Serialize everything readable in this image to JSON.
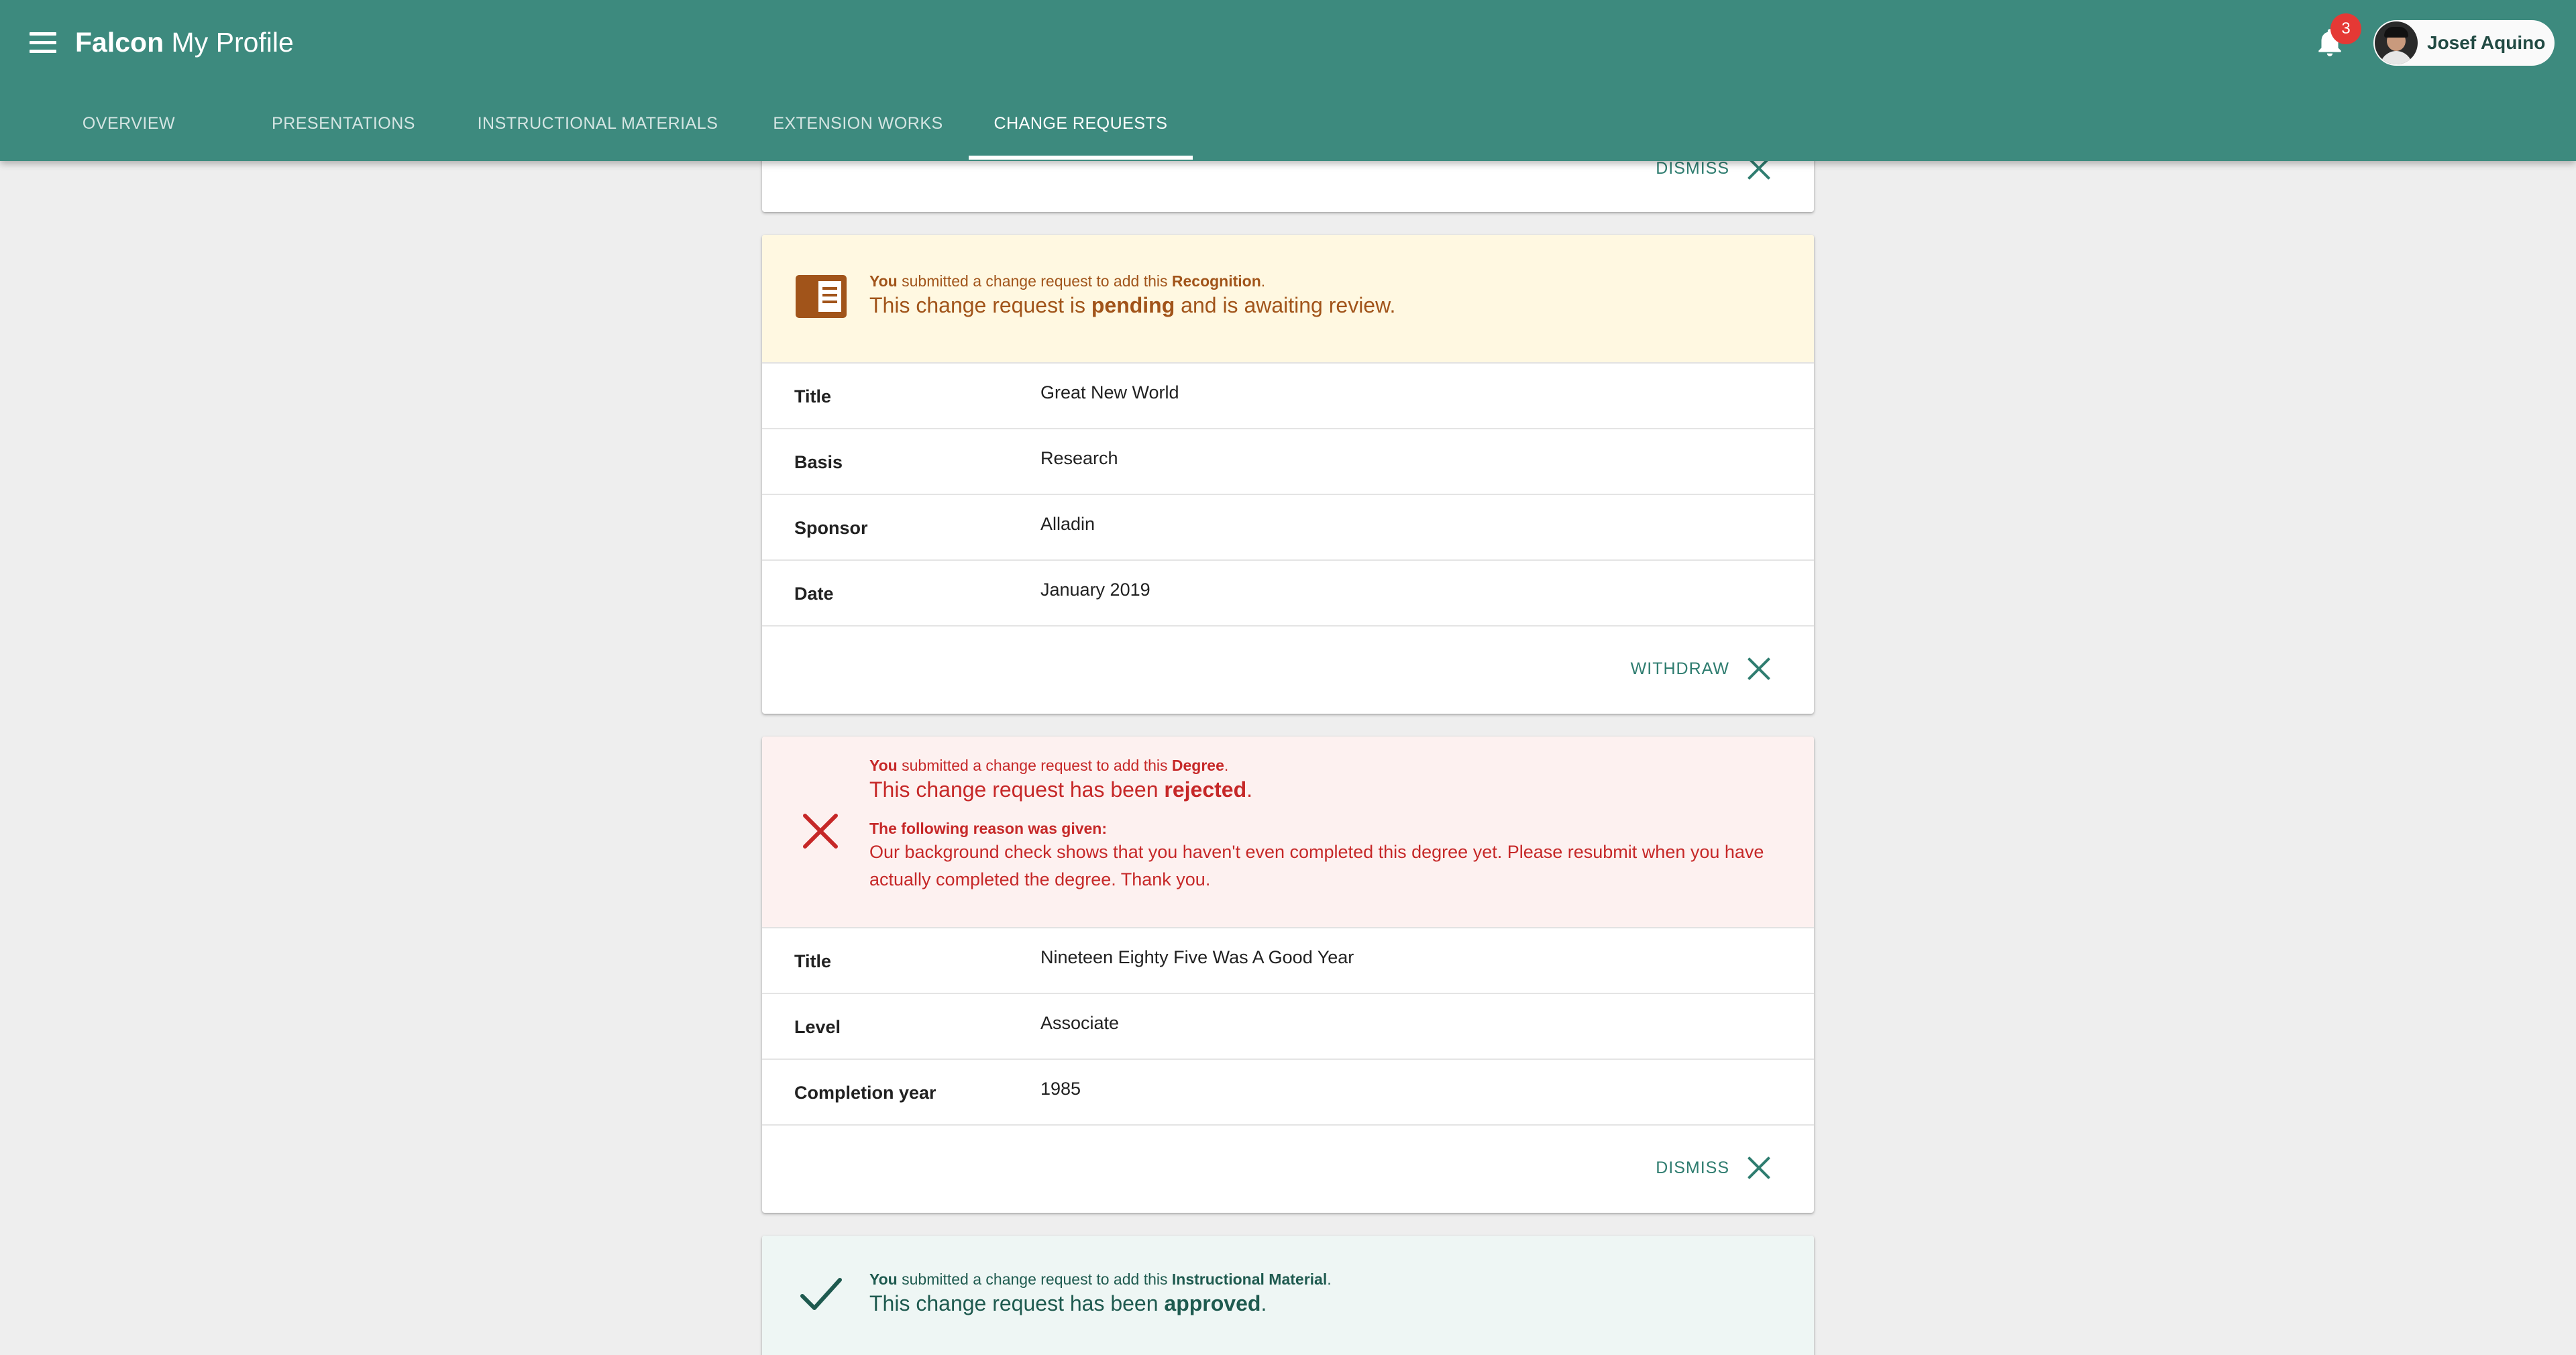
{
  "app": {
    "brand_bold": "Falcon",
    "brand_light": "My Profile",
    "notification_count": "3",
    "user_name": "Josef Aquino"
  },
  "tabs": [
    {
      "label": "OVERVIEW"
    },
    {
      "label": "PRESENTATIONS"
    },
    {
      "label": "INSTRUCTIONAL MATERIALS"
    },
    {
      "label": "EXTENSION WORKS"
    },
    {
      "label": "CHANGE REQUESTS",
      "active": true
    }
  ],
  "top_card": {
    "action_label": "DISMISS"
  },
  "pending_card": {
    "icon": "book-icon",
    "you": "You",
    "submitted": " submitted a change request to add this ",
    "item_type": "Recognition",
    "status_prefix": "This change request is ",
    "status": "pending",
    "status_suffix": " and is awaiting review.",
    "rows": [
      {
        "label": "Title",
        "value": "Great New World"
      },
      {
        "label": "Basis",
        "value": "Research"
      },
      {
        "label": "Sponsor",
        "value": "Alladin"
      },
      {
        "label": "Date",
        "value": "January 2019"
      }
    ],
    "action_label": "WITHDRAW"
  },
  "rejected_card": {
    "icon": "close-icon",
    "you": "You",
    "submitted": " submitted a change request to add this ",
    "item_type": "Degree",
    "status_prefix": "This change request has been ",
    "status": "rejected",
    "reason_label": "The following reason was given:",
    "reason_text": "Our background check shows that you haven't even completed this degree yet. Please resubmit when you have actually completed the degree. Thank you.",
    "rows": [
      {
        "label": "Title",
        "value": "Nineteen Eighty Five Was A Good Year"
      },
      {
        "label": "Level",
        "value": "Associate"
      },
      {
        "label": "Completion year",
        "value": "1985"
      }
    ],
    "action_label": "DISMISS"
  },
  "approved_card": {
    "icon": "checkmark-icon",
    "you": "You",
    "submitted": " submitted a change request to add this ",
    "item_type": "Instructional Material",
    "status_prefix": "This change request has been ",
    "status": "approved"
  },
  "colors": {
    "app_bar": "#3d8a7e",
    "pending_bg": "#fff8e1",
    "pending_text": "#a1541a",
    "rejected_bg": "#fdf1f0",
    "rejected_text": "#c62828",
    "approved_bg": "#eef6f4",
    "approved_text": "#1e5a4f",
    "action_text": "#2f7d70"
  }
}
